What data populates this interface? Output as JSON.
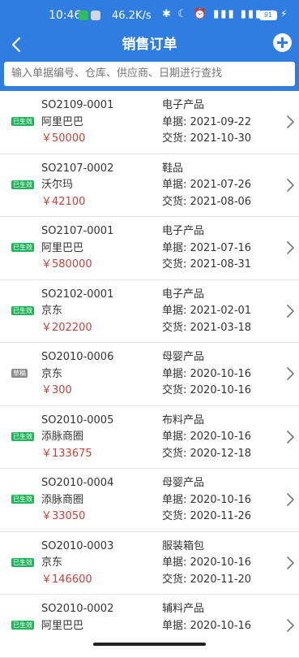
{
  "status_bar": {
    "time": "10:46",
    "speed": "46.2K/s",
    "icons": "✱ ☾ ⏰ ▮▮▮ ▮▮▮ ◠",
    "battery": "91",
    "bolt": "⚡"
  },
  "nav": {
    "title": "销售订单",
    "back_icon": "chevron-left",
    "add_icon": "plus-circle"
  },
  "search": {
    "placeholder": "输入单据编号、仓库、供应商、日期进行查找",
    "value": ""
  },
  "colors": {
    "primary": "#2f7de1",
    "price": "#c9413a",
    "badge_active": "#20b35b",
    "badge_draft": "#8b8b8b"
  },
  "orders": [
    {
      "code": "SO2109-0001",
      "customer": "阿里巴巴",
      "amount": "￥50000",
      "category": "电子产品",
      "bill_date": "单据: 2021-09-22",
      "delivery_date": "交货: 2021-10-30",
      "status": "已生效",
      "status_type": "active"
    },
    {
      "code": "SO2107-0002",
      "customer": "沃尔玛",
      "amount": "￥42100",
      "category": "鞋品",
      "bill_date": "单据: 2021-07-26",
      "delivery_date": "交货: 2021-08-06",
      "status": "已生效",
      "status_type": "active"
    },
    {
      "code": "SO2107-0001",
      "customer": "阿里巴巴",
      "amount": "￥580000",
      "category": "电子产品",
      "bill_date": "单据: 2021-07-16",
      "delivery_date": "交货: 2021-08-31",
      "status": "已生效",
      "status_type": "active"
    },
    {
      "code": "SO2102-0001",
      "customer": "京东",
      "amount": "￥202200",
      "category": "电子产品",
      "bill_date": "单据: 2021-02-01",
      "delivery_date": "交货: 2021-03-18",
      "status": "已生效",
      "status_type": "active"
    },
    {
      "code": "SO2010-0006",
      "customer": "京东",
      "amount": "￥300",
      "category": "母婴产品",
      "bill_date": "单据: 2020-10-16",
      "delivery_date": "交货: 2020-10-16",
      "status": "草稿",
      "status_type": "draft"
    },
    {
      "code": "SO2010-0005",
      "customer": "添脉商圈",
      "amount": "￥133675",
      "category": "布料产品",
      "bill_date": "单据: 2020-10-16",
      "delivery_date": "交货: 2020-12-18",
      "status": "已生效",
      "status_type": "active"
    },
    {
      "code": "SO2010-0004",
      "customer": "添脉商圈",
      "amount": "￥33050",
      "category": "母婴产品",
      "bill_date": "单据: 2020-10-16",
      "delivery_date": "交货: 2020-11-26",
      "status": "已生效",
      "status_type": "active"
    },
    {
      "code": "SO2010-0003",
      "customer": "京东",
      "amount": "￥146600",
      "category": "服装箱包",
      "bill_date": "单据: 2020-10-16",
      "delivery_date": "交货: 2020-11-20",
      "status": "已生效",
      "status_type": "active"
    },
    {
      "code": "SO2010-0002",
      "customer": "阿里巴巴",
      "amount": "",
      "category": "辅料产品",
      "bill_date": "单据: 2020-10-16",
      "delivery_date": "",
      "status": "已生效",
      "status_type": "active"
    }
  ]
}
